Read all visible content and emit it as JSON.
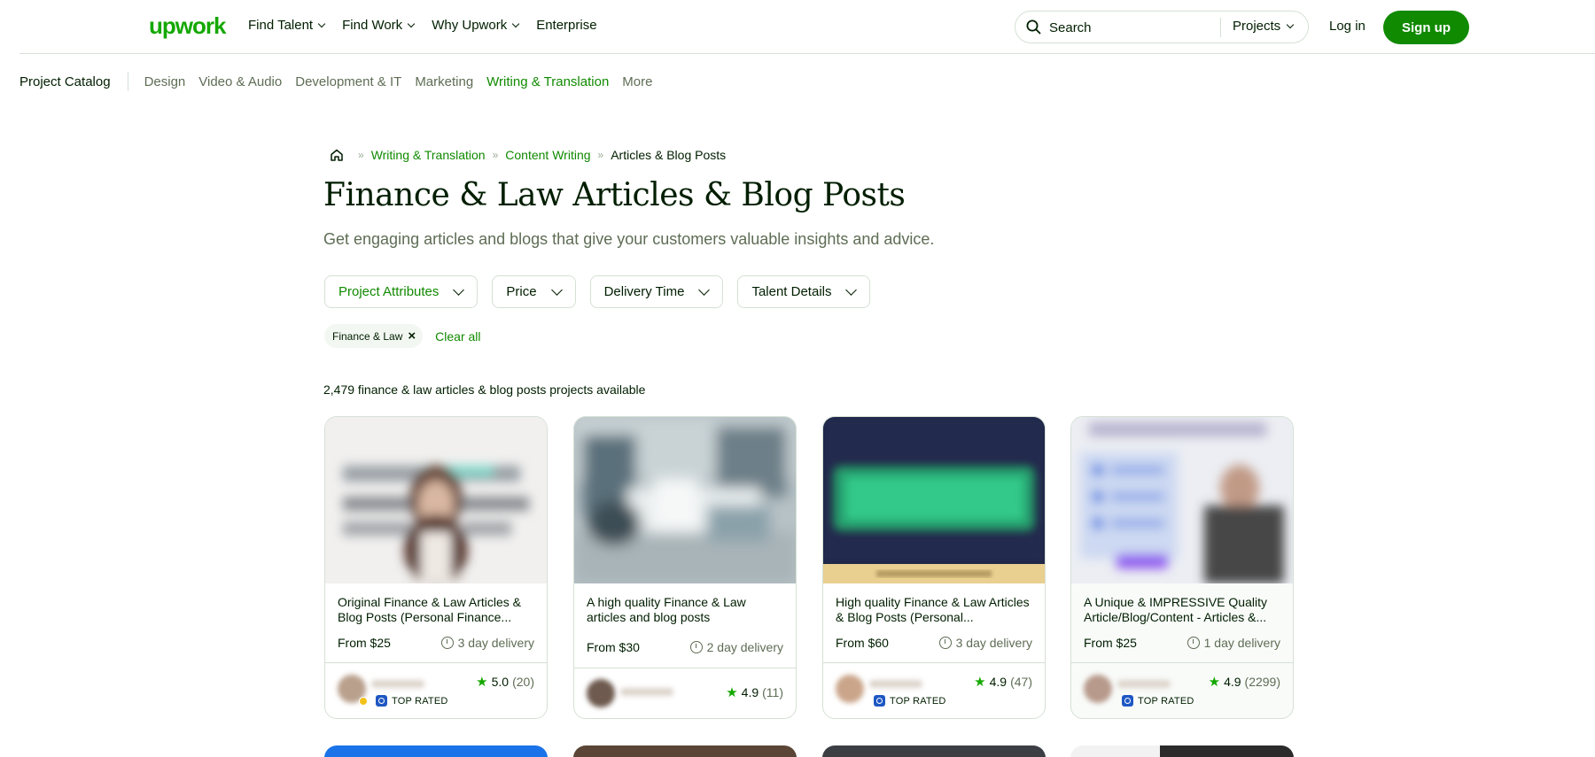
{
  "header": {
    "logo": "upwork",
    "nav": [
      {
        "label": "Find Talent",
        "has_dropdown": true
      },
      {
        "label": "Find Work",
        "has_dropdown": true
      },
      {
        "label": "Why Upwork",
        "has_dropdown": true
      },
      {
        "label": "Enterprise",
        "has_dropdown": false
      }
    ],
    "search": {
      "placeholder": "Search",
      "scope": "Projects"
    },
    "login_label": "Log in",
    "signup_label": "Sign up",
    "accent_color": "#108a00"
  },
  "category_bar": {
    "catalog_label": "Project Catalog",
    "categories": [
      {
        "label": "Design",
        "active": false
      },
      {
        "label": "Video & Audio",
        "active": false
      },
      {
        "label": "Development & IT",
        "active": false
      },
      {
        "label": "Marketing",
        "active": false
      },
      {
        "label": "Writing & Translation",
        "active": true
      },
      {
        "label": "More",
        "active": false
      }
    ]
  },
  "breadcrumb": {
    "items": [
      "Writing & Translation",
      "Content Writing",
      "Articles & Blog Posts"
    ]
  },
  "page": {
    "title": "Finance & Law Articles & Blog Posts",
    "subtitle": "Get engaging articles and blogs that give your customers valuable insights and advice.",
    "filters": [
      {
        "label": "Project Attributes",
        "active": true
      },
      {
        "label": "Price",
        "active": false
      },
      {
        "label": "Delivery Time",
        "active": false
      },
      {
        "label": "Talent Details",
        "active": false
      }
    ],
    "chips": [
      {
        "label": "Finance & Law"
      }
    ],
    "clear_all_label": "Clear all",
    "count_text": "2,479 finance & law articles & blog posts projects available"
  },
  "cards": [
    {
      "title": "Original Finance & Law Articles & Blog Posts (Personal Finance...",
      "price": "From $25",
      "delivery": "3 day delivery",
      "rating": "5.0",
      "reviews": "(20)",
      "badge": "TOP RATED",
      "online": true,
      "thumb_icon": "woman-portrait-thumbnail"
    },
    {
      "title": "A high quality Finance & Law articles and blog posts",
      "price": "From $30",
      "delivery": "2 day delivery",
      "rating": "4.9",
      "reviews": "(11)",
      "badge": "",
      "online": false,
      "thumb_icon": "office-desk-thumbnail"
    },
    {
      "title": "High quality Finance & Law Articles & Blog Posts (Personal...",
      "price": "From $60",
      "delivery": "3 day delivery",
      "rating": "4.9",
      "reviews": "(47)",
      "badge": "TOP RATED",
      "online": false,
      "thumb_icon": "finance-word-thumbnail"
    },
    {
      "title": "A Unique & IMPRESSIVE Quality Article/Blog/Content - Articles &...",
      "price": "From $25",
      "delivery": "1 day delivery",
      "rating": "4.9",
      "reviews": "(2299)",
      "badge": "TOP RATED",
      "online": false,
      "thumb_icon": "article-blog-content-thumbnail"
    }
  ]
}
